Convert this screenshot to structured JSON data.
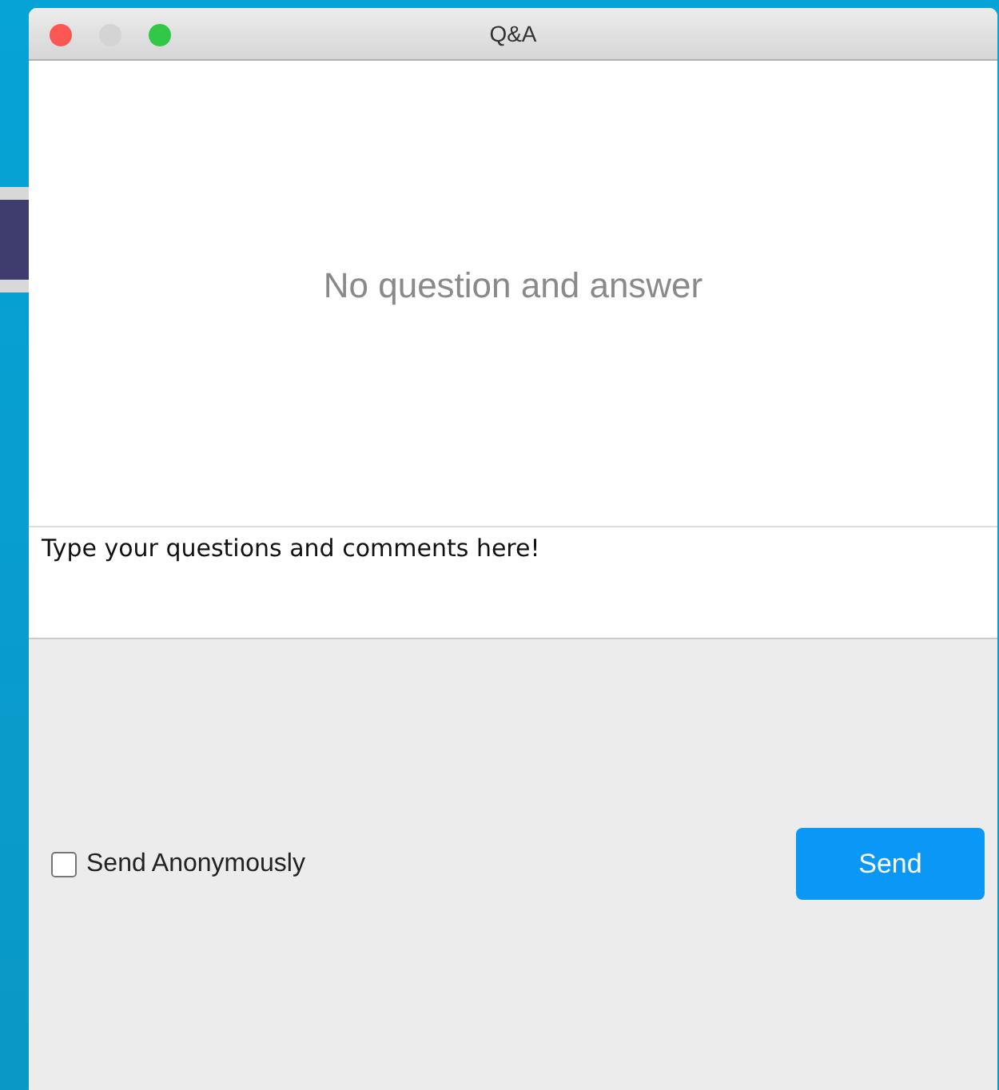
{
  "window": {
    "title": "Q&A",
    "controls": [
      {
        "kind": "close",
        "disabled": false
      },
      {
        "kind": "minimize",
        "disabled": true
      },
      {
        "kind": "zoom",
        "disabled": false
      }
    ]
  },
  "empty_message": "No question and answer",
  "question_field": {
    "value": "Type your questions and comments here!"
  },
  "anonymous_checkbox": {
    "label": "Send Anonymously",
    "checked": false
  },
  "send_button": {
    "label": "Send"
  }
}
